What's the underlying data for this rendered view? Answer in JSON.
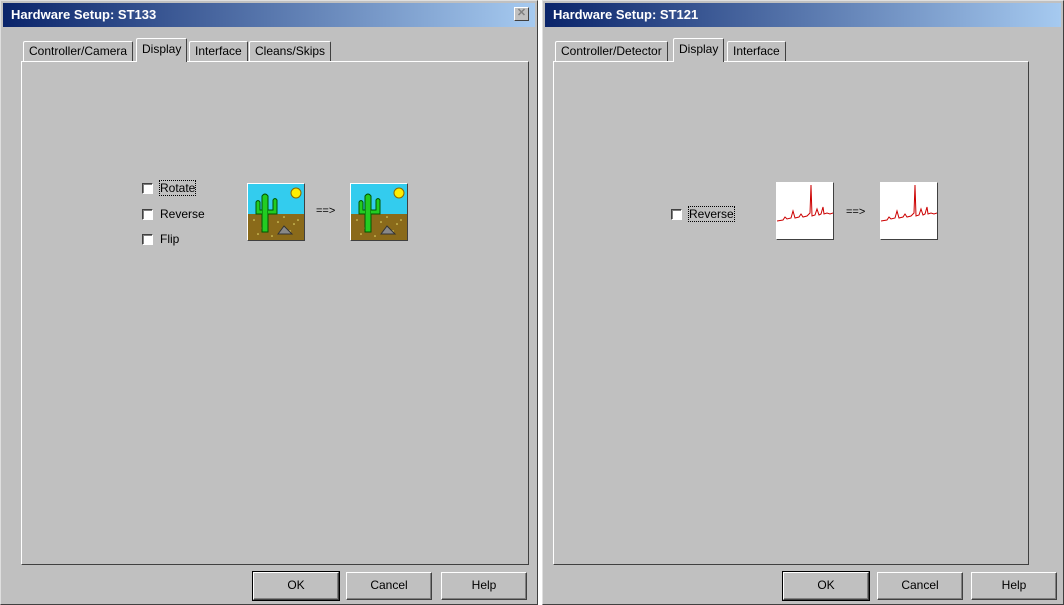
{
  "dialog_left": {
    "title": "Hardware Setup: ST133",
    "tabs": [
      "Controller/Camera",
      "Display",
      "Interface",
      "Cleans/Skips"
    ],
    "active_tab": "Display",
    "options": [
      {
        "label": "Rotate",
        "checked": false
      },
      {
        "label": "Reverse",
        "checked": false
      },
      {
        "label": "Flip",
        "checked": false
      }
    ],
    "arrow": "==>",
    "preview_image": "cactus-scene",
    "buttons": {
      "ok": "OK",
      "cancel": "Cancel",
      "help": "Help"
    }
  },
  "dialog_right": {
    "title": "Hardware Setup: ST121",
    "tabs": [
      "Controller/Detector",
      "Display",
      "Interface"
    ],
    "active_tab": "Display",
    "options": [
      {
        "label": "Reverse",
        "checked": false
      }
    ],
    "arrow": "==>",
    "preview_image": "spectrum-plot",
    "buttons": {
      "ok": "OK",
      "cancel": "Cancel",
      "help": "Help"
    }
  },
  "icons": {
    "close": "close-icon"
  },
  "colors": {
    "title_start": "#0a246a",
    "title_end": "#a6caf0",
    "face": "#c0c0c0",
    "spectrum": "#cc0000"
  }
}
